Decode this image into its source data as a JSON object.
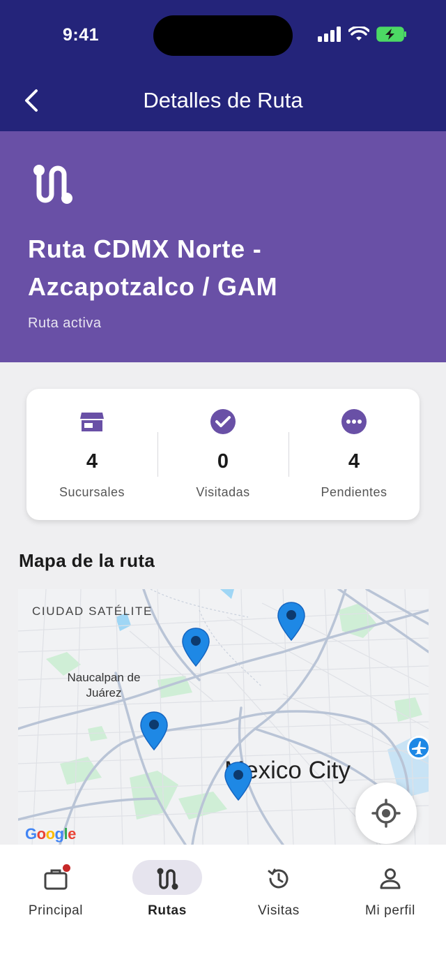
{
  "status_bar": {
    "time": "9:41"
  },
  "header": {
    "title": "Detalles de Ruta"
  },
  "route": {
    "name": "Ruta CDMX Norte - Azcapotzalco / GAM",
    "status": "Ruta activa"
  },
  "stats": [
    {
      "icon": "store-icon",
      "value": "4",
      "label": "Sucursales"
    },
    {
      "icon": "check-circle-icon",
      "value": "0",
      "label": "Visitadas"
    },
    {
      "icon": "more-circle-icon",
      "value": "4",
      "label": "Pendientes"
    }
  ],
  "map_section": {
    "title": "Mapa de la ruta",
    "labels": {
      "satelite": "CIUDAD SATÉLITE",
      "naucalpan": "Naucalpan de Juárez",
      "city": "Mexico City"
    },
    "attribution": "Google"
  },
  "colors": {
    "header": "#24247a",
    "hero": "#6950a6",
    "accent": "#6950a6",
    "pin": "#1e88e5"
  },
  "nav": [
    {
      "icon": "briefcase-icon",
      "label": "Principal",
      "active": false,
      "badge": true
    },
    {
      "icon": "route-icon",
      "label": "Rutas",
      "active": true,
      "badge": false
    },
    {
      "icon": "history-icon",
      "label": "Visitas",
      "active": false,
      "badge": false
    },
    {
      "icon": "person-icon",
      "label": "Mi perfil",
      "active": false,
      "badge": false
    }
  ]
}
